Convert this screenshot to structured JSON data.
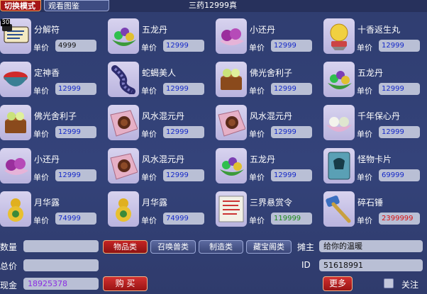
{
  "header": {
    "tabs": [
      {
        "label": "切换模式",
        "active": true
      },
      {
        "label": "观看图鉴",
        "active": false
      }
    ],
    "title": "三药12999真"
  },
  "price_label": "单价",
  "items": [
    {
      "name": "分解符",
      "price": "4999",
      "price_color": "#111111",
      "icon": "scroll-icon",
      "badge": "30"
    },
    {
      "name": "五龙丹",
      "price": "12999",
      "price_color": "#1428c8",
      "icon": "green-pills-icon"
    },
    {
      "name": "小还丹",
      "price": "12999",
      "price_color": "#1428c8",
      "icon": "purple-pills-icon"
    },
    {
      "name": "十香返生丸",
      "price": "12999",
      "price_color": "#1428c8",
      "icon": "golden-orb-icon"
    },
    {
      "name": "定神香",
      "price": "12999",
      "price_color": "#1428c8",
      "icon": "incense-bowl-icon"
    },
    {
      "name": "蛇蝎美人",
      "price": "12999",
      "price_color": "#1428c8",
      "icon": "centipede-icon"
    },
    {
      "name": "佛光舍利子",
      "price": "12999",
      "price_color": "#1428c8",
      "icon": "relic-box-icon"
    },
    {
      "name": "五龙丹",
      "price": "12999",
      "price_color": "#1428c8",
      "icon": "green-pills-icon"
    },
    {
      "name": "佛光舍利子",
      "price": "12999",
      "price_color": "#1428c8",
      "icon": "relic-box-icon"
    },
    {
      "name": "风水混元丹",
      "price": "12999",
      "price_color": "#1428c8",
      "icon": "cloth-pill-icon"
    },
    {
      "name": "风水混元丹",
      "price": "12999",
      "price_color": "#1428c8",
      "icon": "cloth-pill-icon"
    },
    {
      "name": "千年保心丹",
      "price": "12999",
      "price_color": "#1428c8",
      "icon": "white-pills-icon"
    },
    {
      "name": "小还丹",
      "price": "12999",
      "price_color": "#1428c8",
      "icon": "purple-pills-icon"
    },
    {
      "name": "风水混元丹",
      "price": "12999",
      "price_color": "#1428c8",
      "icon": "cloth-pill-icon"
    },
    {
      "name": "五龙丹",
      "price": "12999",
      "price_color": "#1428c8",
      "icon": "green-pills-icon"
    },
    {
      "name": "怪物卡片",
      "price": "69999",
      "price_color": "#1428c8",
      "icon": "monster-card-icon"
    },
    {
      "name": "月华露",
      "price": "74999",
      "price_color": "#1428c8",
      "icon": "gourd-icon"
    },
    {
      "name": "月华露",
      "price": "74999",
      "price_color": "#1428c8",
      "icon": "gourd-icon"
    },
    {
      "name": "三界悬赏令",
      "price": "119999",
      "price_color": "#1a8a1a",
      "icon": "bounty-notice-icon"
    },
    {
      "name": "碎石锤",
      "price": "2399999",
      "price_color": "#d81010",
      "icon": "hammer-icon"
    }
  ],
  "controls": {
    "quantity_label": "数量",
    "quantity_value": "",
    "total_label": "总价",
    "total_value": "",
    "cash_label": "现金",
    "cash_value": "18925378",
    "cash_color": "#8a2be2",
    "categories": [
      "物品类",
      "召唤兽类",
      "制造类",
      "藏宝阁类"
    ],
    "active_category": "物品类",
    "buy_label": "购 买",
    "owner_label": "摊主",
    "owner_value": "给你的温暖",
    "id_label": "ID",
    "id_value": "51618991",
    "more_label": "更多",
    "follow_label": "关注"
  }
}
